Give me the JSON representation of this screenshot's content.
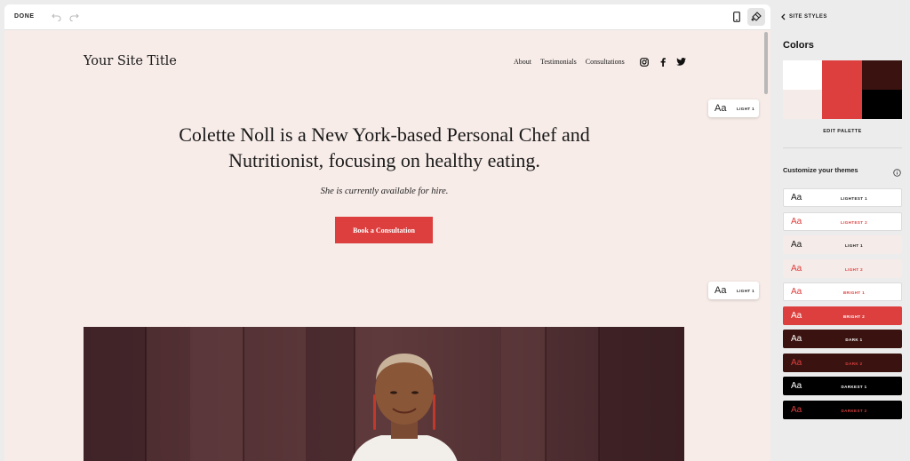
{
  "toolbar": {
    "done_label": "DONE"
  },
  "site": {
    "title": "Your Site Title",
    "nav": [
      "About",
      "Testimonials",
      "Consultations"
    ],
    "social_icons": [
      "instagram-icon",
      "facebook-icon",
      "twitter-icon"
    ]
  },
  "hero": {
    "heading_line1": "Colette Noll is a New York-based Personal Chef and",
    "heading_line2": "Nutritionist, focusing on healthy eating.",
    "subheading": "She is currently available for hire.",
    "cta_label": "Book a Consultation"
  },
  "section_badges": [
    {
      "aa": "Aa",
      "label": "LIGHT 1"
    },
    {
      "aa": "Aa",
      "label": "LIGHT 1"
    }
  ],
  "panel": {
    "back_label": "SITE STYLES",
    "colors_title": "Colors",
    "palette": [
      "#ffffff",
      "#dc3f3e",
      "#3a1310",
      "#f5ebe8",
      "#dc3f3e",
      "#000000"
    ],
    "edit_palette_label": "EDIT PALETTE",
    "themes_title": "Customize your themes",
    "themes": [
      {
        "aa": "Aa",
        "name": "LIGHTEST 1",
        "bg": "#ffffff",
        "fg": "#1a1a1a"
      },
      {
        "aa": "Aa",
        "name": "LIGHTEST 2",
        "bg": "#ffffff",
        "fg": "#dc3f3e"
      },
      {
        "aa": "Aa",
        "name": "LIGHT 1",
        "bg": "#f5ebe8",
        "fg": "#1a1a1a"
      },
      {
        "aa": "Aa",
        "name": "LIGHT 2",
        "bg": "#f5ebe8",
        "fg": "#dc3f3e"
      },
      {
        "aa": "Aa",
        "name": "BRIGHT 1",
        "bg": "#ffffff",
        "fg": "#dc3f3e"
      },
      {
        "aa": "Aa",
        "name": "BRIGHT 2",
        "bg": "#dc3f3e",
        "fg": "#ffffff"
      },
      {
        "aa": "Aa",
        "name": "DARK 1",
        "bg": "#3a1310",
        "fg": "#ffffff"
      },
      {
        "aa": "Aa",
        "name": "DARK 2",
        "bg": "#3a1310",
        "fg": "#dc3f3e"
      },
      {
        "aa": "Aa",
        "name": "DARKEST 1",
        "bg": "#000000",
        "fg": "#ffffff"
      },
      {
        "aa": "Aa",
        "name": "DARKEST 2",
        "bg": "#000000",
        "fg": "#dc3f3e"
      }
    ]
  }
}
